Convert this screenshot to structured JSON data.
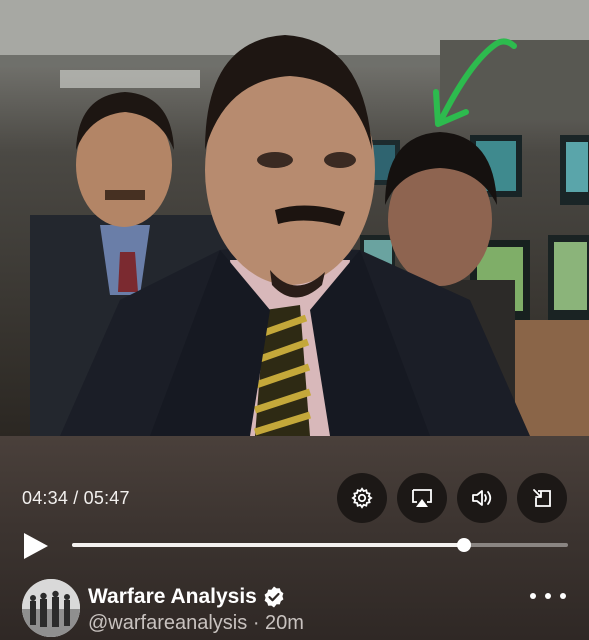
{
  "player": {
    "current_time": "04:34",
    "separator": "/",
    "duration": "05:47",
    "progress": 0.79
  },
  "controls": {
    "icons": [
      "gear-icon",
      "airplay-icon",
      "volume-icon",
      "popout-icon"
    ],
    "play_icon": "play-icon"
  },
  "post": {
    "author_name": "Warfare Analysis",
    "handle": "@warfareanalysis",
    "dot": "·",
    "age": "20m",
    "verified": true
  },
  "colors": {
    "arrow": "#2dbb4e",
    "panel": "#3c3430",
    "button": "#1c1816"
  }
}
